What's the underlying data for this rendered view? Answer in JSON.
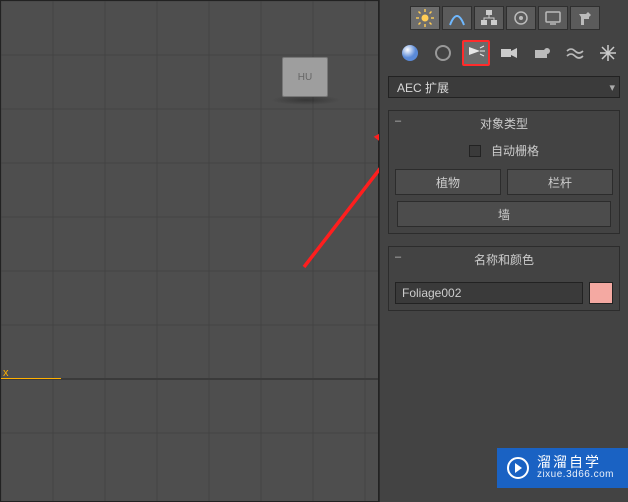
{
  "viewport": {
    "cube_label": "HU",
    "axis_x": "x"
  },
  "panel": {
    "top_tabs": [
      {
        "name": "create-tab",
        "icon": "sun-icon"
      },
      {
        "name": "modify-tab",
        "icon": "modify-icon"
      },
      {
        "name": "hierarchy-tab",
        "icon": "hierarchy-icon"
      },
      {
        "name": "motion-tab",
        "icon": "motion-icon"
      },
      {
        "name": "display-tab",
        "icon": "display-icon"
      },
      {
        "name": "utilities-tab",
        "icon": "hammer-icon"
      }
    ],
    "sub_tabs": [
      {
        "name": "geometry-sub",
        "icon": "sphere-icon"
      },
      {
        "name": "shapes-sub",
        "icon": "shapes-icon"
      },
      {
        "name": "lights-sub",
        "icon": "lights-icon"
      },
      {
        "name": "cameras-sub",
        "icon": "camera-icon"
      },
      {
        "name": "helpers-sub",
        "icon": "helper-icon"
      },
      {
        "name": "spacewarp-sub",
        "icon": "wave-icon"
      },
      {
        "name": "systems-sub",
        "icon": "star-icon"
      }
    ],
    "highlighted_sub_index": 2,
    "dropdown_value": "AEC 扩展",
    "object_type": {
      "title": "对象类型",
      "auto_grid_label": "自动栅格",
      "auto_grid_checked": false,
      "buttons": [
        "植物",
        "栏杆",
        "墙"
      ]
    },
    "name_color": {
      "title": "名称和颜色",
      "name_value": "Foliage002",
      "swatch_hex": "#f4a9a2"
    }
  },
  "watermark": {
    "cn": "溜溜自学",
    "url": "zixue.3d66.com"
  }
}
